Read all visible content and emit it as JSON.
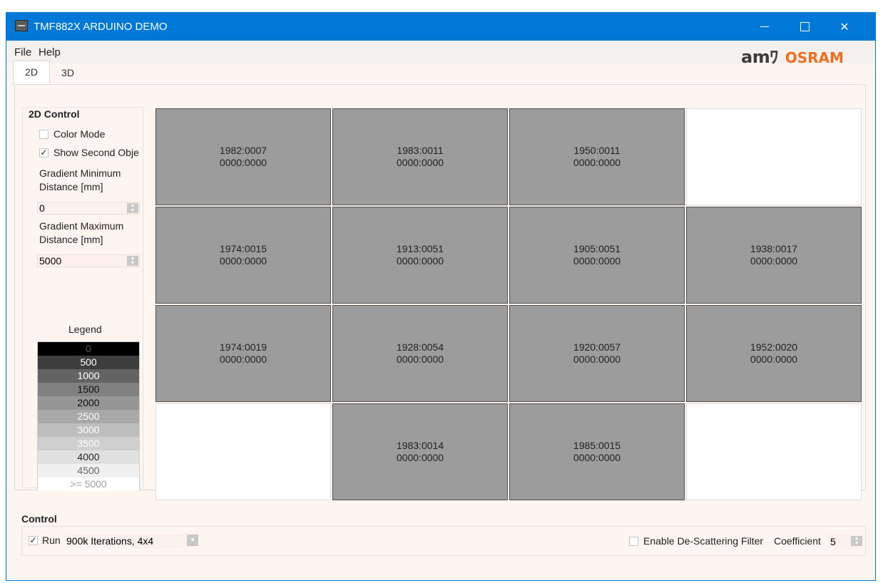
{
  "window": {
    "title": "TMF882X ARDUINO DEMO"
  },
  "menu": {
    "file": "File",
    "help": "Help"
  },
  "logo": {
    "ams": "ams",
    "osram": "OSRAM"
  },
  "tabs": [
    {
      "label": "2D"
    },
    {
      "label": "3D"
    }
  ],
  "control_2d": {
    "title": "2D Control",
    "color_mode": {
      "label": "Color Mode",
      "checked": false
    },
    "show_second": {
      "label": "Show Second Obje",
      "checked": true
    },
    "grad_min_label_1": "Gradient Minimum",
    "grad_min_label_2": "Distance [mm]",
    "grad_min_value": "0",
    "grad_max_label_1": "Gradient Maximum",
    "grad_max_label_2": "Distance [mm]",
    "grad_max_value": "5000"
  },
  "legend": {
    "title": "Legend",
    "items": [
      {
        "label": "0",
        "bg": "#000000",
        "fg": "#555555"
      },
      {
        "label": "500",
        "bg": "#3d3d3d",
        "fg": "#ffffff"
      },
      {
        "label": "1000",
        "bg": "#636363",
        "fg": "#ffffff"
      },
      {
        "label": "1500",
        "bg": "#818181",
        "fg": "#111111"
      },
      {
        "label": "2000",
        "bg": "#969696",
        "fg": "#111111"
      },
      {
        "label": "2500",
        "bg": "#a9a9a9",
        "fg": "#ffffff"
      },
      {
        "label": "3000",
        "bg": "#bdbdbd",
        "fg": "#ffffff"
      },
      {
        "label": "3500",
        "bg": "#cfcfcf",
        "fg": "#ffffff"
      },
      {
        "label": "4000",
        "bg": "#e0e0e0",
        "fg": "#222222"
      },
      {
        "label": "4500",
        "bg": "#f0f0f0",
        "fg": "#666666"
      },
      {
        "label": ">= 5000",
        "bg": "#ffffff",
        "fg": "#a0a0a0"
      }
    ]
  },
  "grid": [
    {
      "row": 0,
      "col": 0,
      "line1": "1982:0007",
      "line2": "0000:0000",
      "color": "gray"
    },
    {
      "row": 0,
      "col": 1,
      "line1": "1983:0011",
      "line2": "0000:0000",
      "color": "gray"
    },
    {
      "row": 0,
      "col": 2,
      "line1": "1950:0011",
      "line2": "0000:0000",
      "color": "gray"
    },
    {
      "row": 0,
      "col": 3,
      "line1": "",
      "line2": "",
      "color": "white"
    },
    {
      "row": 1,
      "col": 0,
      "line1": "1974:0015",
      "line2": "0000:0000",
      "color": "gray"
    },
    {
      "row": 1,
      "col": 1,
      "line1": "1913:0051",
      "line2": "0000:0000",
      "color": "gray"
    },
    {
      "row": 1,
      "col": 2,
      "line1": "1905:0051",
      "line2": "0000:0000",
      "color": "gray"
    },
    {
      "row": 1,
      "col": 3,
      "line1": "1938:0017",
      "line2": "0000:0000",
      "color": "gray"
    },
    {
      "row": 2,
      "col": 0,
      "line1": "1974:0019",
      "line2": "0000:0000",
      "color": "gray"
    },
    {
      "row": 2,
      "col": 1,
      "line1": "1928:0054",
      "line2": "0000:0000",
      "color": "gray"
    },
    {
      "row": 2,
      "col": 2,
      "line1": "1920:0057",
      "line2": "0000:0000",
      "color": "gray"
    },
    {
      "row": 2,
      "col": 3,
      "line1": "1952:0020",
      "line2": "0000:0000",
      "color": "gray"
    },
    {
      "row": 3,
      "col": 0,
      "line1": "",
      "line2": "",
      "color": "white"
    },
    {
      "row": 3,
      "col": 1,
      "line1": "1983:0014",
      "line2": "0000:0000",
      "color": "gray"
    },
    {
      "row": 3,
      "col": 2,
      "line1": "1985:0015",
      "line2": "0000:0000",
      "color": "gray"
    },
    {
      "row": 3,
      "col": 3,
      "line1": "",
      "line2": "",
      "color": "white"
    }
  ],
  "control": {
    "title": "Control",
    "run": {
      "label": "Run",
      "checked": true
    },
    "mode_value": "900k Iterations, 4x4",
    "descatter": {
      "label": "Enable De-Scattering Filter",
      "checked": false
    },
    "coefficient_label": "Coefficient",
    "coefficient_value": "5"
  }
}
